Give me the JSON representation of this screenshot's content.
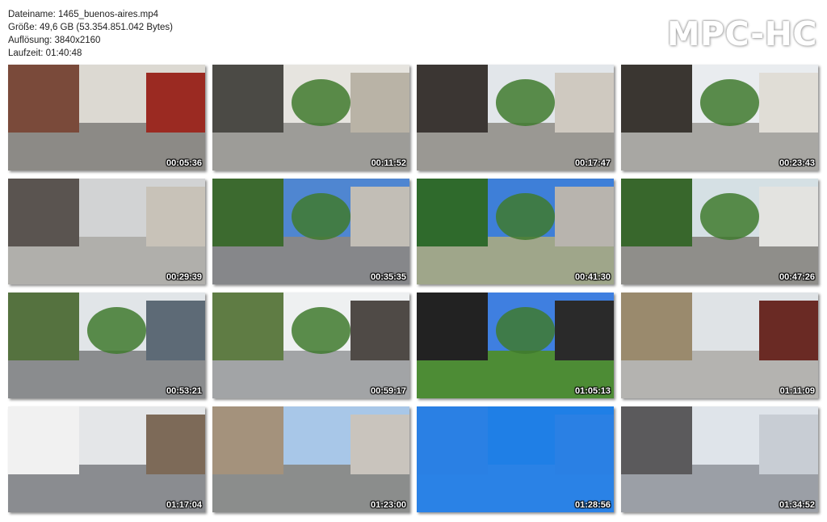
{
  "info": {
    "filename": "Dateiname: 1465_buenos-aires.mp4",
    "size": "Größe: 49,6 GB (53.354.851.042 Bytes)",
    "resolution": "Auflösung: 3840x2160",
    "duration": "Laufzeit: 01:40:48"
  },
  "logo": "MPC-HC",
  "thumbnails": [
    {
      "time": "00:05:36",
      "sky": "#dcd9d2",
      "ground": "#8c8a86",
      "left": "#7a4a3a",
      "right": "#9b2a22",
      "tree": false
    },
    {
      "time": "00:11:52",
      "sky": "#e6e4df",
      "ground": "#9d9c98",
      "left": "#4b4a45",
      "right": "#b9b3a6",
      "tree": true
    },
    {
      "time": "00:17:47",
      "sky": "#e2e6ea",
      "ground": "#9a9893",
      "left": "#3b3633",
      "right": "#cfc9c0",
      "tree": true
    },
    {
      "time": "00:23:43",
      "sky": "#e9ecef",
      "ground": "#a8a7a3",
      "left": "#3a3631",
      "right": "#e0ddd6",
      "tree": true
    },
    {
      "time": "00:29:39",
      "sky": "#d2d3d4",
      "ground": "#b0afab",
      "left": "#5a5450",
      "right": "#c8c2b8",
      "tree": false
    },
    {
      "time": "00:35:35",
      "sky": "#4f86d1",
      "ground": "#86878a",
      "left": "#3c6a2f",
      "right": "#c2beb6",
      "tree": true
    },
    {
      "time": "00:41:30",
      "sky": "#3e7fd8",
      "ground": "#9fa68a",
      "left": "#2f6a2c",
      "right": "#b8b4ae",
      "tree": true
    },
    {
      "time": "00:47:26",
      "sky": "#d5e0e4",
      "ground": "#8f8e8a",
      "left": "#38672c",
      "right": "#e3e3e0",
      "tree": true
    },
    {
      "time": "00:53:21",
      "sky": "#e1e5e8",
      "ground": "#8a8c8e",
      "left": "#55723f",
      "right": "#5d6a76",
      "tree": true
    },
    {
      "time": "00:59:17",
      "sky": "#eef0f1",
      "ground": "#a2a4a6",
      "left": "#5f7c44",
      "right": "#4f4a46",
      "tree": true
    },
    {
      "time": "01:05:13",
      "sky": "#3f7fe0",
      "ground": "#4d8c35",
      "left": "#222222",
      "right": "#2a2a2a",
      "tree": true
    },
    {
      "time": "01:11:09",
      "sky": "#dfe3e6",
      "ground": "#b4b3b0",
      "left": "#9a8a6d",
      "right": "#6a2a24",
      "tree": false
    },
    {
      "time": "01:17:04",
      "sky": "#e4e6e8",
      "ground": "#8a8c90",
      "left": "#f1f1f1",
      "right": "#7d6a58",
      "tree": false
    },
    {
      "time": "01:23:00",
      "sky": "#a8c7e8",
      "ground": "#8b8d8c",
      "left": "#a4927c",
      "right": "#c9c4bd",
      "tree": false
    },
    {
      "time": "01:28:56",
      "sky": "#1f7fe6",
      "ground": "#2a82e6",
      "left": "#2a80e4",
      "right": "#2a80e4",
      "tree": false
    },
    {
      "time": "01:34:52",
      "sky": "#dfe4ea",
      "ground": "#9b9fa6",
      "left": "#5b5a5c",
      "right": "#c8cdd4",
      "tree": false
    }
  ]
}
